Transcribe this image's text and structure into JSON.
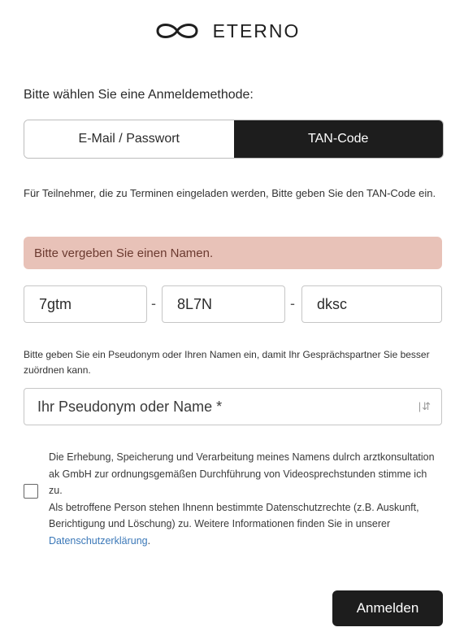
{
  "brand": {
    "name": "ETERNO",
    "logo_icon": "infinity-icon"
  },
  "login": {
    "prompt": "Bitte wählen Sie eine Anmeldemethode:",
    "tabs": [
      {
        "label": "E-Mail / Passwort",
        "active": false
      },
      {
        "label": "TAN-Code",
        "active": true
      }
    ],
    "info": "Für Teilnehmer, die zu Terminen eingeladen werden, Bitte geben Sie den TAN-Code ein.",
    "error": "Bitte vergeben Sie einen Namen.",
    "tan": {
      "part1": "7gtm",
      "part2": "8L7N",
      "part3": "dksc",
      "separator": "-"
    },
    "pseudonym_info": "Bitte geben Sie ein Pseudonym oder Ihren Namen ein, damit Ihr Gesprächspartner Sie besser zuördnen kann.",
    "name_placeholder": "Ihr Pseudonym oder Name *",
    "name_field_icon": "autofill-icon",
    "consent": {
      "checked": false,
      "line1": "Die Erhebung, Speicherung und Verarbeitung meines Namens dulrch arztkonsultation ak GmbH zur ordnungsgemäßen Durchführung von Videosprechstunden stimme ich zu.",
      "line2_prefix": "Als betroffene Person stehen Ihnenn bestimmte Datenschutzrechte (z.B. Auskunft, Berichtigung und Löschung) zu. Weitere Informationen finden Sie in unserer ",
      "link": "Datenschutzerklärung",
      "line2_suffix": "."
    },
    "submit": "Anmelden"
  }
}
